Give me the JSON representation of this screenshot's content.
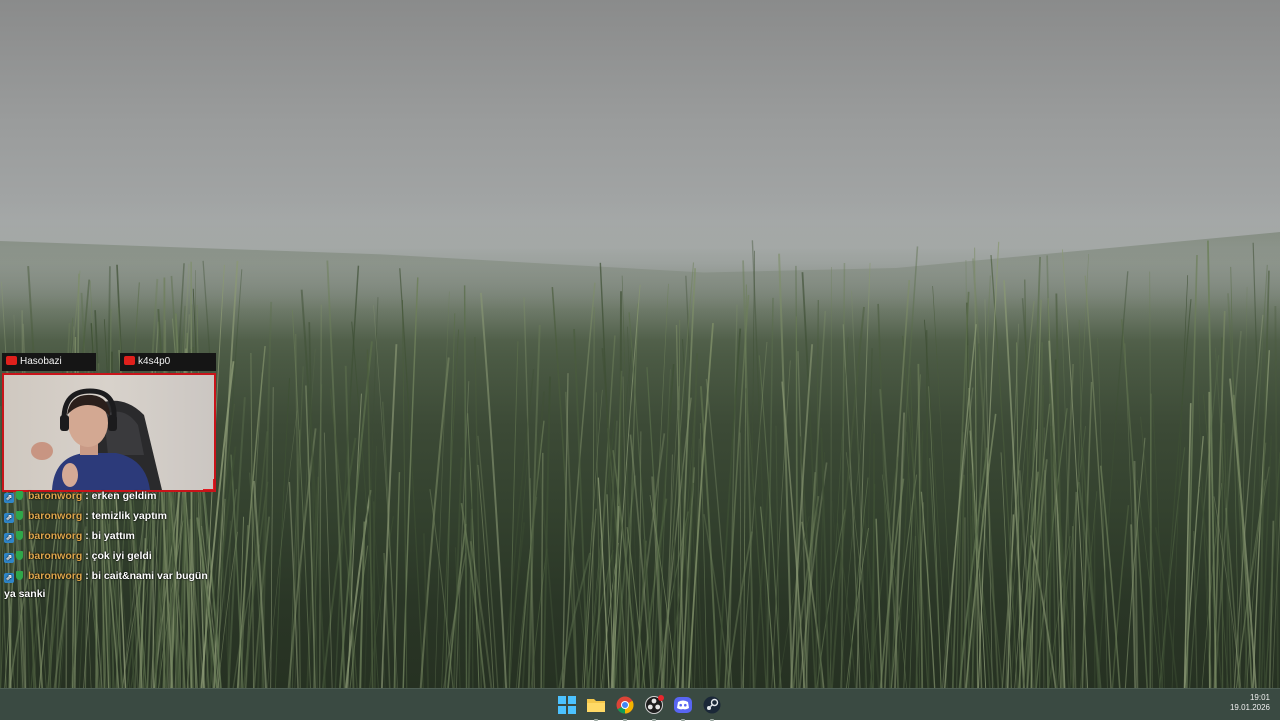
{
  "overlay": {
    "cam_tags": [
      {
        "platform_icon": "youtube-icon",
        "label": "Hasobazi"
      },
      {
        "platform_icon": "youtube-icon",
        "label": "k4s4p0"
      }
    ],
    "accent_color": "#c8141a"
  },
  "chat": {
    "messages": [
      {
        "user": "baronworg",
        "text": ": erken geldim"
      },
      {
        "user": "baronworg",
        "text": ": temizlik yaptım"
      },
      {
        "user": "baronworg",
        "text": ": bi yattım"
      },
      {
        "user": "baronworg",
        "text": ": çok iyi geldi"
      },
      {
        "user": "baronworg",
        "text": ": bi cait&nami var bugün",
        "wrap": "ya sanki"
      }
    ],
    "username_color": "#e0a84d"
  },
  "taskbar": {
    "icons": [
      {
        "name": "start-icon",
        "running": false
      },
      {
        "name": "file-explorer-icon",
        "running": true
      },
      {
        "name": "chrome-icon",
        "running": true
      },
      {
        "name": "obs-icon",
        "running": true,
        "notification": true
      },
      {
        "name": "discord-icon",
        "running": true
      },
      {
        "name": "steam-icon",
        "running": true
      }
    ],
    "clock": {
      "time": "19:01",
      "date": "19.01.2026"
    }
  }
}
